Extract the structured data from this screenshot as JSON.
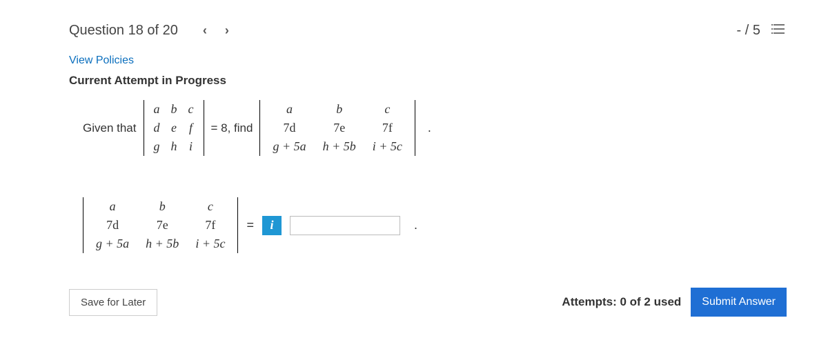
{
  "header": {
    "title": "Question 18 of 20",
    "score": "- / 5"
  },
  "links": {
    "view_policies": "View Policies"
  },
  "status": {
    "attempt_heading": "Current Attempt in Progress",
    "attempts_text": "Attempts: 0 of 2 used"
  },
  "problem": {
    "given_prefix": "Given that",
    "det1": {
      "r1": [
        "a",
        "b",
        "c"
      ],
      "r2": [
        "d",
        "e",
        "f"
      ],
      "r3": [
        "g",
        "h",
        "i"
      ]
    },
    "equals_value": "= 8",
    "find_word": ", find",
    "det2": {
      "r1": [
        "a",
        "b",
        "c"
      ],
      "r2": [
        "7d",
        "7e",
        "7f"
      ],
      "r3": [
        "g + 5a",
        "h + 5b",
        "i + 5c"
      ]
    },
    "period": "."
  },
  "answer": {
    "det": {
      "r1": [
        "a",
        "b",
        "c"
      ],
      "r2": [
        "7d",
        "7e",
        "7f"
      ],
      "r3": [
        "g + 5a",
        "h + 5b",
        "i + 5c"
      ]
    },
    "equals": "=",
    "info_icon": "i",
    "value": "",
    "period2": "."
  },
  "buttons": {
    "save": "Save for Later",
    "submit": "Submit Answer"
  }
}
